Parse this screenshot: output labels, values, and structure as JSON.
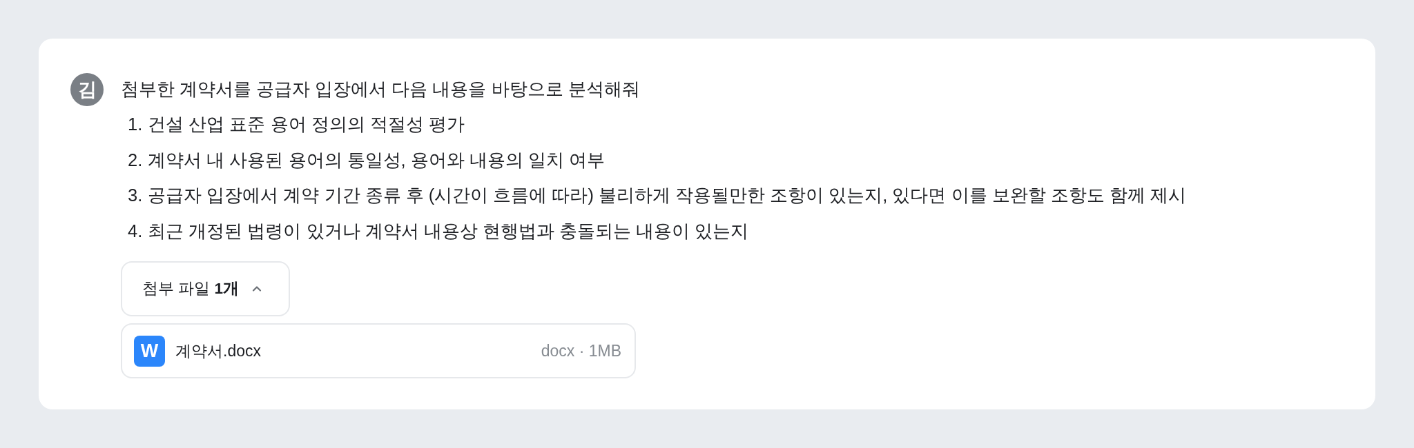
{
  "message": {
    "avatar": "김",
    "text": "첨부한 계약서를 공급자 입장에서 다음 내용을 바탕으로 분석해줘",
    "items": [
      {
        "number": "1.",
        "text": "건설 산업 표준 용어 정의의 적절성 평가"
      },
      {
        "number": "2.",
        "text": "계약서 내 사용된 용어의 통일성, 용어와 내용의 일치 여부"
      },
      {
        "number": "3.",
        "text": "공급자 입장에서 계약 기간 종류 후 (시간이 흐름에 따라) 불리하게 작용될만한 조항이 있는지, 있다면 이를 보완할 조항도 함께 제시"
      },
      {
        "number": "4.",
        "text": "최근 개정된 법령이 있거나 계약서 내용상 현행법과 충돌되는 내용이 있는지"
      }
    ]
  },
  "attachments": {
    "toggle": {
      "label": "첨부 파일 **1개**",
      "expanded": true
    },
    "files": [
      {
        "icon_letter": "W",
        "name": "계약서.docx",
        "meta": "docx · 1MB"
      }
    ]
  }
}
